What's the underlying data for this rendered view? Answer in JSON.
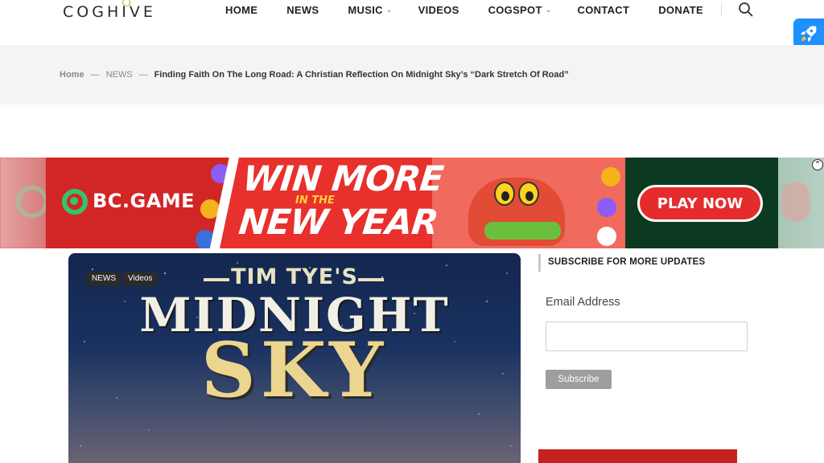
{
  "header": {
    "logo_text": "COGHIVE",
    "nav": [
      {
        "label": "HOME",
        "has_dropdown": false
      },
      {
        "label": "NEWS",
        "has_dropdown": false
      },
      {
        "label": "MUSIC",
        "has_dropdown": true
      },
      {
        "label": "VIDEOS",
        "has_dropdown": false
      },
      {
        "label": "COGSPOT",
        "has_dropdown": true
      },
      {
        "label": "CONTACT",
        "has_dropdown": false
      },
      {
        "label": "DONATE",
        "has_dropdown": false
      }
    ],
    "icons": {
      "search": "search-icon",
      "rocket": "rocket-icon",
      "dropdown": "chevron-down-icon"
    }
  },
  "breadcrumb": {
    "home": "Home",
    "section": "NEWS",
    "separator": "—",
    "current": "Finding Faith On The Long Road: A Christian Reflection On Midnight Sky’s “Dark Stretch Of Road”"
  },
  "ad": {
    "brand": "BC.GAME",
    "headline_1": "WIN MORE",
    "headline_in_the": "IN THE",
    "headline_2": "NEW YEAR",
    "cta": "PLAY NOW",
    "choices_icon": "adchoices-icon"
  },
  "feature": {
    "tags": [
      "NEWS",
      "Videos"
    ],
    "line_1": "TIM TYE'S",
    "line_2": "MIDNIGHT",
    "line_3": "SKY"
  },
  "sidebar": {
    "heading": "SUBSCRIBE FOR MORE UPDATES",
    "email_label": "Email Address",
    "email_value": "",
    "subscribe_label": "Subscribe"
  },
  "colors": {
    "accent_blue": "#1e90ff",
    "ad_red": "#dd2a2a",
    "ad_green": "#0c3a20",
    "sidebar_red": "#c4211f"
  }
}
